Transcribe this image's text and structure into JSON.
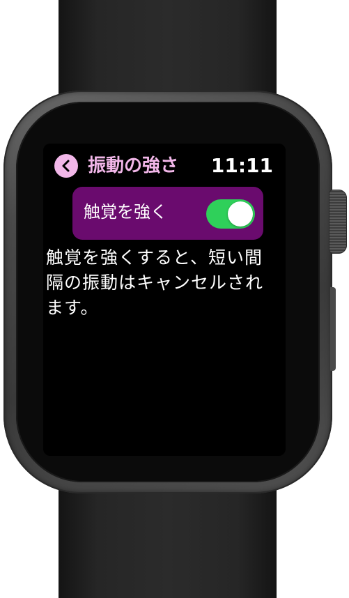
{
  "header": {
    "title": "振動の強さ",
    "time": "11:11",
    "back_icon": "chevron-left-icon"
  },
  "setting": {
    "label": "触覚を強く",
    "toggle_state": "on"
  },
  "description": "触覚を強くすると、短い間隔の振動はキャンセルされます。",
  "colors": {
    "accent": "#f2b7e9",
    "row_background": "#6a0b6e",
    "toggle_on": "#2fd05a"
  }
}
